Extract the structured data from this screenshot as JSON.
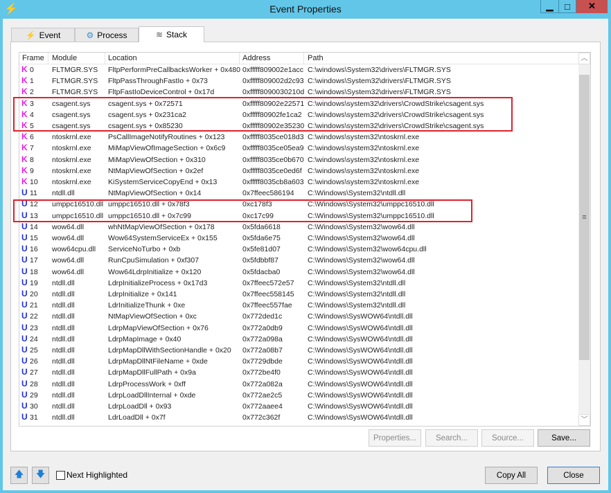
{
  "window": {
    "title": "Event Properties",
    "minimize": "▁",
    "maximize": "□",
    "close": "✕"
  },
  "tabs": [
    {
      "label": "Event",
      "icon": "⚡"
    },
    {
      "label": "Process",
      "icon": "⚙"
    },
    {
      "label": "Stack",
      "icon": "≋"
    }
  ],
  "columns": [
    "Frame",
    "Module",
    "Location",
    "Address",
    "Path"
  ],
  "colors": {
    "kernel": "#e81ee8",
    "user": "#1f2fe0",
    "highlight": "#e0202a"
  },
  "rows": [
    {
      "t": "K",
      "f": "0",
      "m": "FLTMGR.SYS",
      "l": "FltpPerformPreCallbacksWorker + 0x480",
      "a": "0xfffff809002e1acc",
      "p": "C:\\windows\\System32\\drivers\\FLTMGR.SYS"
    },
    {
      "t": "K",
      "f": "1",
      "m": "FLTMGR.SYS",
      "l": "FltpPassThroughFastIo + 0x73",
      "a": "0xfffff809002d2c93",
      "p": "C:\\windows\\System32\\drivers\\FLTMGR.SYS"
    },
    {
      "t": "K",
      "f": "2",
      "m": "FLTMGR.SYS",
      "l": "FltpFastIoDeviceControl + 0x17d",
      "a": "0xfffff8090030210d",
      "p": "C:\\windows\\System32\\drivers\\FLTMGR.SYS"
    },
    {
      "t": "K",
      "f": "3",
      "m": "csagent.sys",
      "l": "csagent.sys + 0x72571",
      "a": "0xfffff80902e22571",
      "p": "C:\\windows\\system32\\drivers\\CrowdStrike\\csagent.sys"
    },
    {
      "t": "K",
      "f": "4",
      "m": "csagent.sys",
      "l": "csagent.sys + 0x231ca2",
      "a": "0xfffff80902fe1ca2",
      "p": "C:\\windows\\system32\\drivers\\CrowdStrike\\csagent.sys"
    },
    {
      "t": "K",
      "f": "5",
      "m": "csagent.sys",
      "l": "csagent.sys + 0x85230",
      "a": "0xfffff80902e35230",
      "p": "C:\\windows\\system32\\drivers\\CrowdStrike\\csagent.sys"
    },
    {
      "t": "K",
      "f": "6",
      "m": "ntoskrnl.exe",
      "l": "PsCallImageNotifyRoutines + 0x123",
      "a": "0xfffff8035ce018d3",
      "p": "C:\\windows\\system32\\ntoskrnl.exe"
    },
    {
      "t": "K",
      "f": "7",
      "m": "ntoskrnl.exe",
      "l": "MiMapViewOfImageSection + 0x6c9",
      "a": "0xfffff8035ce05ea9",
      "p": "C:\\windows\\system32\\ntoskrnl.exe"
    },
    {
      "t": "K",
      "f": "8",
      "m": "ntoskrnl.exe",
      "l": "MiMapViewOfSection + 0x310",
      "a": "0xfffff8035ce0b670",
      "p": "C:\\windows\\system32\\ntoskrnl.exe"
    },
    {
      "t": "K",
      "f": "9",
      "m": "ntoskrnl.exe",
      "l": "NtMapViewOfSection + 0x2ef",
      "a": "0xfffff8035ce0ed6f",
      "p": "C:\\windows\\system32\\ntoskrnl.exe"
    },
    {
      "t": "K",
      "f": "10",
      "m": "ntoskrnl.exe",
      "l": "KiSystemServiceCopyEnd + 0x13",
      "a": "0xfffff8035cb8a603",
      "p": "C:\\windows\\system32\\ntoskrnl.exe"
    },
    {
      "t": "U",
      "f": "11",
      "m": "ntdll.dll",
      "l": "NtMapViewOfSection + 0x14",
      "a": "0x7ffeec586194",
      "p": "C:\\Windows\\System32\\ntdll.dll"
    },
    {
      "t": "U",
      "f": "12",
      "m": "umppc16510.dll",
      "l": "umppc16510.dll + 0x78f3",
      "a": "0xc178f3",
      "p": "C:\\Windows\\System32\\umppc16510.dll"
    },
    {
      "t": "U",
      "f": "13",
      "m": "umppc16510.dll",
      "l": "umppc16510.dll + 0x7c99",
      "a": "0xc17c99",
      "p": "C:\\Windows\\System32\\umppc16510.dll"
    },
    {
      "t": "U",
      "f": "14",
      "m": "wow64.dll",
      "l": "whNtMapViewOfSection + 0x178",
      "a": "0x5fda6618",
      "p": "C:\\Windows\\System32\\wow64.dll"
    },
    {
      "t": "U",
      "f": "15",
      "m": "wow64.dll",
      "l": "Wow64SystemServiceEx + 0x155",
      "a": "0x5fda6e75",
      "p": "C:\\Windows\\System32\\wow64.dll"
    },
    {
      "t": "U",
      "f": "16",
      "m": "wow64cpu.dll",
      "l": "ServiceNoTurbo + 0xb",
      "a": "0x5fe81d07",
      "p": "C:\\Windows\\System32\\wow64cpu.dll"
    },
    {
      "t": "U",
      "f": "17",
      "m": "wow64.dll",
      "l": "RunCpuSimulation + 0xf307",
      "a": "0x5fdbbf87",
      "p": "C:\\Windows\\System32\\wow64.dll"
    },
    {
      "t": "U",
      "f": "18",
      "m": "wow64.dll",
      "l": "Wow64LdrpInitialize + 0x120",
      "a": "0x5fdacba0",
      "p": "C:\\Windows\\System32\\wow64.dll"
    },
    {
      "t": "U",
      "f": "19",
      "m": "ntdll.dll",
      "l": "LdrpInitializeProcess + 0x17d3",
      "a": "0x7ffeec572e57",
      "p": "C:\\Windows\\System32\\ntdll.dll"
    },
    {
      "t": "U",
      "f": "20",
      "m": "ntdll.dll",
      "l": "LdrpInitialize + 0x141",
      "a": "0x7ffeec558145",
      "p": "C:\\Windows\\System32\\ntdll.dll"
    },
    {
      "t": "U",
      "f": "21",
      "m": "ntdll.dll",
      "l": "LdrInitializeThunk + 0xe",
      "a": "0x7ffeec557fae",
      "p": "C:\\Windows\\System32\\ntdll.dll"
    },
    {
      "t": "U",
      "f": "22",
      "m": "ntdll.dll",
      "l": "NtMapViewOfSection + 0xc",
      "a": "0x772ded1c",
      "p": "C:\\Windows\\SysWOW64\\ntdll.dll"
    },
    {
      "t": "U",
      "f": "23",
      "m": "ntdll.dll",
      "l": "LdrpMapViewOfSection + 0x76",
      "a": "0x772a0db9",
      "p": "C:\\Windows\\SysWOW64\\ntdll.dll"
    },
    {
      "t": "U",
      "f": "24",
      "m": "ntdll.dll",
      "l": "LdrpMapImage + 0x40",
      "a": "0x772a098a",
      "p": "C:\\Windows\\SysWOW64\\ntdll.dll"
    },
    {
      "t": "U",
      "f": "25",
      "m": "ntdll.dll",
      "l": "LdrpMapDllWithSectionHandle + 0x20",
      "a": "0x772a08b7",
      "p": "C:\\Windows\\SysWOW64\\ntdll.dll"
    },
    {
      "t": "U",
      "f": "26",
      "m": "ntdll.dll",
      "l": "LdrpMapDllNtFileName + 0xde",
      "a": "0x7729dbde",
      "p": "C:\\Windows\\SysWOW64\\ntdll.dll"
    },
    {
      "t": "U",
      "f": "27",
      "m": "ntdll.dll",
      "l": "LdrpMapDllFullPath + 0x9a",
      "a": "0x772be4f0",
      "p": "C:\\Windows\\SysWOW64\\ntdll.dll"
    },
    {
      "t": "U",
      "f": "28",
      "m": "ntdll.dll",
      "l": "LdrpProcessWork + 0xff",
      "a": "0x772a082a",
      "p": "C:\\Windows\\SysWOW64\\ntdll.dll"
    },
    {
      "t": "U",
      "f": "29",
      "m": "ntdll.dll",
      "l": "LdrpLoadDllInternal + 0xde",
      "a": "0x772ae2c5",
      "p": "C:\\Windows\\SysWOW64\\ntdll.dll"
    },
    {
      "t": "U",
      "f": "30",
      "m": "ntdll.dll",
      "l": "LdrpLoadDll + 0x93",
      "a": "0x772aaee4",
      "p": "C:\\Windows\\SysWOW64\\ntdll.dll"
    },
    {
      "t": "U",
      "f": "31",
      "m": "ntdll.dll",
      "l": "LdrLoadDll + 0x7f",
      "a": "0x772c362f",
      "p": "C:\\Windows\\SysWOW64\\ntdll.dll"
    }
  ],
  "panel_buttons": {
    "properties": "Properties...",
    "search": "Search...",
    "source": "Source...",
    "save": "Save..."
  },
  "footer": {
    "up": "🡅",
    "down": "🡇",
    "next_highlighted": "Next Highlighted",
    "copy_all": "Copy All",
    "close": "Close"
  }
}
